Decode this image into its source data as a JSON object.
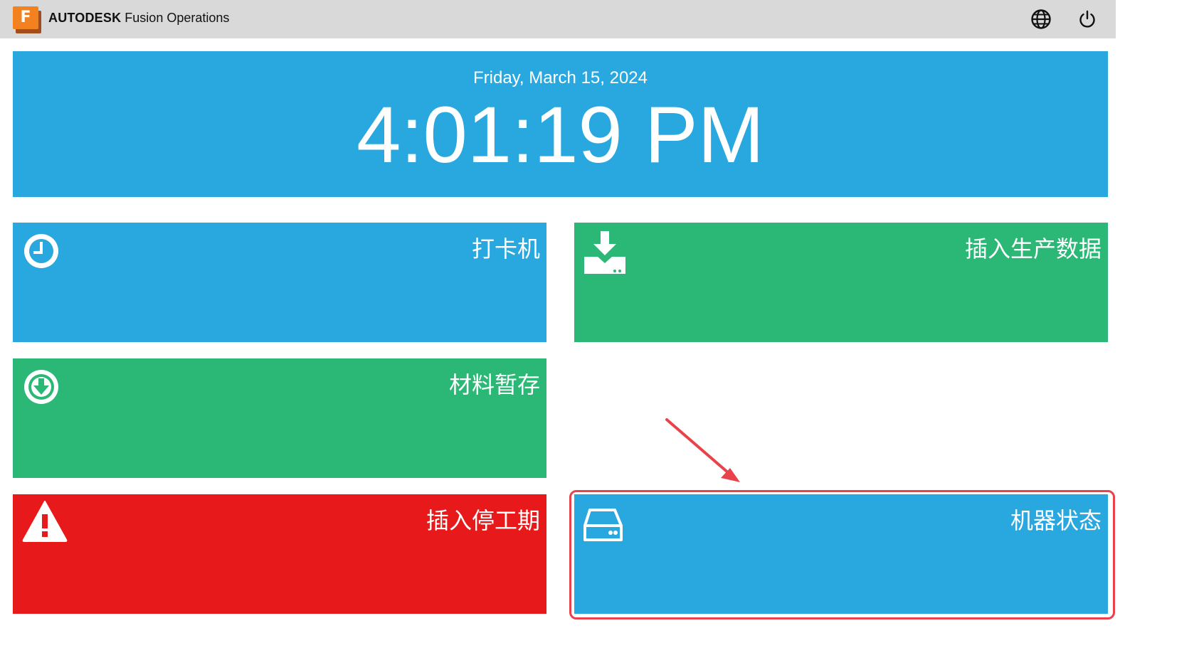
{
  "app": {
    "logo_letter": "F",
    "brand": "AUTODESK",
    "product": "Fusion Operations"
  },
  "topbar": {
    "icons": [
      "globe-icon",
      "power-icon"
    ]
  },
  "banner": {
    "date": "Friday, March 15, 2024",
    "time": "4:01:19 PM"
  },
  "tiles": [
    {
      "label": "打卡机",
      "color": "#29a8e0",
      "icon": "clock-icon"
    },
    {
      "label": "插入生产数据",
      "color": "#2bb877",
      "icon": "download-tray-icon"
    },
    {
      "label": "材料暂存",
      "color": "#2bb877",
      "icon": "download-circle-icon"
    },
    {
      "label": "插入停工期",
      "color": "#e8191a",
      "icon": "warning-icon"
    },
    {
      "label": "机器状态",
      "color": "#29a8e0",
      "icon": "hard-drive-icon"
    }
  ],
  "colors": {
    "topbar": "#d9d9d9",
    "banner": "#29a8e0",
    "annotation": "#e8434a"
  }
}
